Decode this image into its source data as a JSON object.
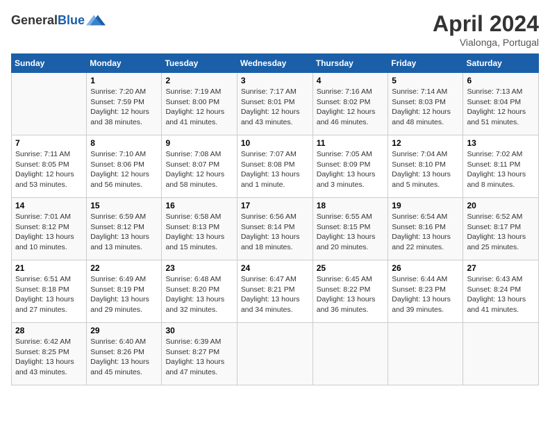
{
  "header": {
    "logo_general": "General",
    "logo_blue": "Blue",
    "month_title": "April 2024",
    "location": "Vialonga, Portugal"
  },
  "weekdays": [
    "Sunday",
    "Monday",
    "Tuesday",
    "Wednesday",
    "Thursday",
    "Friday",
    "Saturday"
  ],
  "weeks": [
    [
      {
        "day": "",
        "info": ""
      },
      {
        "day": "1",
        "info": "Sunrise: 7:20 AM\nSunset: 7:59 PM\nDaylight: 12 hours\nand 38 minutes."
      },
      {
        "day": "2",
        "info": "Sunrise: 7:19 AM\nSunset: 8:00 PM\nDaylight: 12 hours\nand 41 minutes."
      },
      {
        "day": "3",
        "info": "Sunrise: 7:17 AM\nSunset: 8:01 PM\nDaylight: 12 hours\nand 43 minutes."
      },
      {
        "day": "4",
        "info": "Sunrise: 7:16 AM\nSunset: 8:02 PM\nDaylight: 12 hours\nand 46 minutes."
      },
      {
        "day": "5",
        "info": "Sunrise: 7:14 AM\nSunset: 8:03 PM\nDaylight: 12 hours\nand 48 minutes."
      },
      {
        "day": "6",
        "info": "Sunrise: 7:13 AM\nSunset: 8:04 PM\nDaylight: 12 hours\nand 51 minutes."
      }
    ],
    [
      {
        "day": "7",
        "info": "Sunrise: 7:11 AM\nSunset: 8:05 PM\nDaylight: 12 hours\nand 53 minutes."
      },
      {
        "day": "8",
        "info": "Sunrise: 7:10 AM\nSunset: 8:06 PM\nDaylight: 12 hours\nand 56 minutes."
      },
      {
        "day": "9",
        "info": "Sunrise: 7:08 AM\nSunset: 8:07 PM\nDaylight: 12 hours\nand 58 minutes."
      },
      {
        "day": "10",
        "info": "Sunrise: 7:07 AM\nSunset: 8:08 PM\nDaylight: 13 hours\nand 1 minute."
      },
      {
        "day": "11",
        "info": "Sunrise: 7:05 AM\nSunset: 8:09 PM\nDaylight: 13 hours\nand 3 minutes."
      },
      {
        "day": "12",
        "info": "Sunrise: 7:04 AM\nSunset: 8:10 PM\nDaylight: 13 hours\nand 5 minutes."
      },
      {
        "day": "13",
        "info": "Sunrise: 7:02 AM\nSunset: 8:11 PM\nDaylight: 13 hours\nand 8 minutes."
      }
    ],
    [
      {
        "day": "14",
        "info": "Sunrise: 7:01 AM\nSunset: 8:12 PM\nDaylight: 13 hours\nand 10 minutes."
      },
      {
        "day": "15",
        "info": "Sunrise: 6:59 AM\nSunset: 8:12 PM\nDaylight: 13 hours\nand 13 minutes."
      },
      {
        "day": "16",
        "info": "Sunrise: 6:58 AM\nSunset: 8:13 PM\nDaylight: 13 hours\nand 15 minutes."
      },
      {
        "day": "17",
        "info": "Sunrise: 6:56 AM\nSunset: 8:14 PM\nDaylight: 13 hours\nand 18 minutes."
      },
      {
        "day": "18",
        "info": "Sunrise: 6:55 AM\nSunset: 8:15 PM\nDaylight: 13 hours\nand 20 minutes."
      },
      {
        "day": "19",
        "info": "Sunrise: 6:54 AM\nSunset: 8:16 PM\nDaylight: 13 hours\nand 22 minutes."
      },
      {
        "day": "20",
        "info": "Sunrise: 6:52 AM\nSunset: 8:17 PM\nDaylight: 13 hours\nand 25 minutes."
      }
    ],
    [
      {
        "day": "21",
        "info": "Sunrise: 6:51 AM\nSunset: 8:18 PM\nDaylight: 13 hours\nand 27 minutes."
      },
      {
        "day": "22",
        "info": "Sunrise: 6:49 AM\nSunset: 8:19 PM\nDaylight: 13 hours\nand 29 minutes."
      },
      {
        "day": "23",
        "info": "Sunrise: 6:48 AM\nSunset: 8:20 PM\nDaylight: 13 hours\nand 32 minutes."
      },
      {
        "day": "24",
        "info": "Sunrise: 6:47 AM\nSunset: 8:21 PM\nDaylight: 13 hours\nand 34 minutes."
      },
      {
        "day": "25",
        "info": "Sunrise: 6:45 AM\nSunset: 8:22 PM\nDaylight: 13 hours\nand 36 minutes."
      },
      {
        "day": "26",
        "info": "Sunrise: 6:44 AM\nSunset: 8:23 PM\nDaylight: 13 hours\nand 39 minutes."
      },
      {
        "day": "27",
        "info": "Sunrise: 6:43 AM\nSunset: 8:24 PM\nDaylight: 13 hours\nand 41 minutes."
      }
    ],
    [
      {
        "day": "28",
        "info": "Sunrise: 6:42 AM\nSunset: 8:25 PM\nDaylight: 13 hours\nand 43 minutes."
      },
      {
        "day": "29",
        "info": "Sunrise: 6:40 AM\nSunset: 8:26 PM\nDaylight: 13 hours\nand 45 minutes."
      },
      {
        "day": "30",
        "info": "Sunrise: 6:39 AM\nSunset: 8:27 PM\nDaylight: 13 hours\nand 47 minutes."
      },
      {
        "day": "",
        "info": ""
      },
      {
        "day": "",
        "info": ""
      },
      {
        "day": "",
        "info": ""
      },
      {
        "day": "",
        "info": ""
      }
    ]
  ]
}
